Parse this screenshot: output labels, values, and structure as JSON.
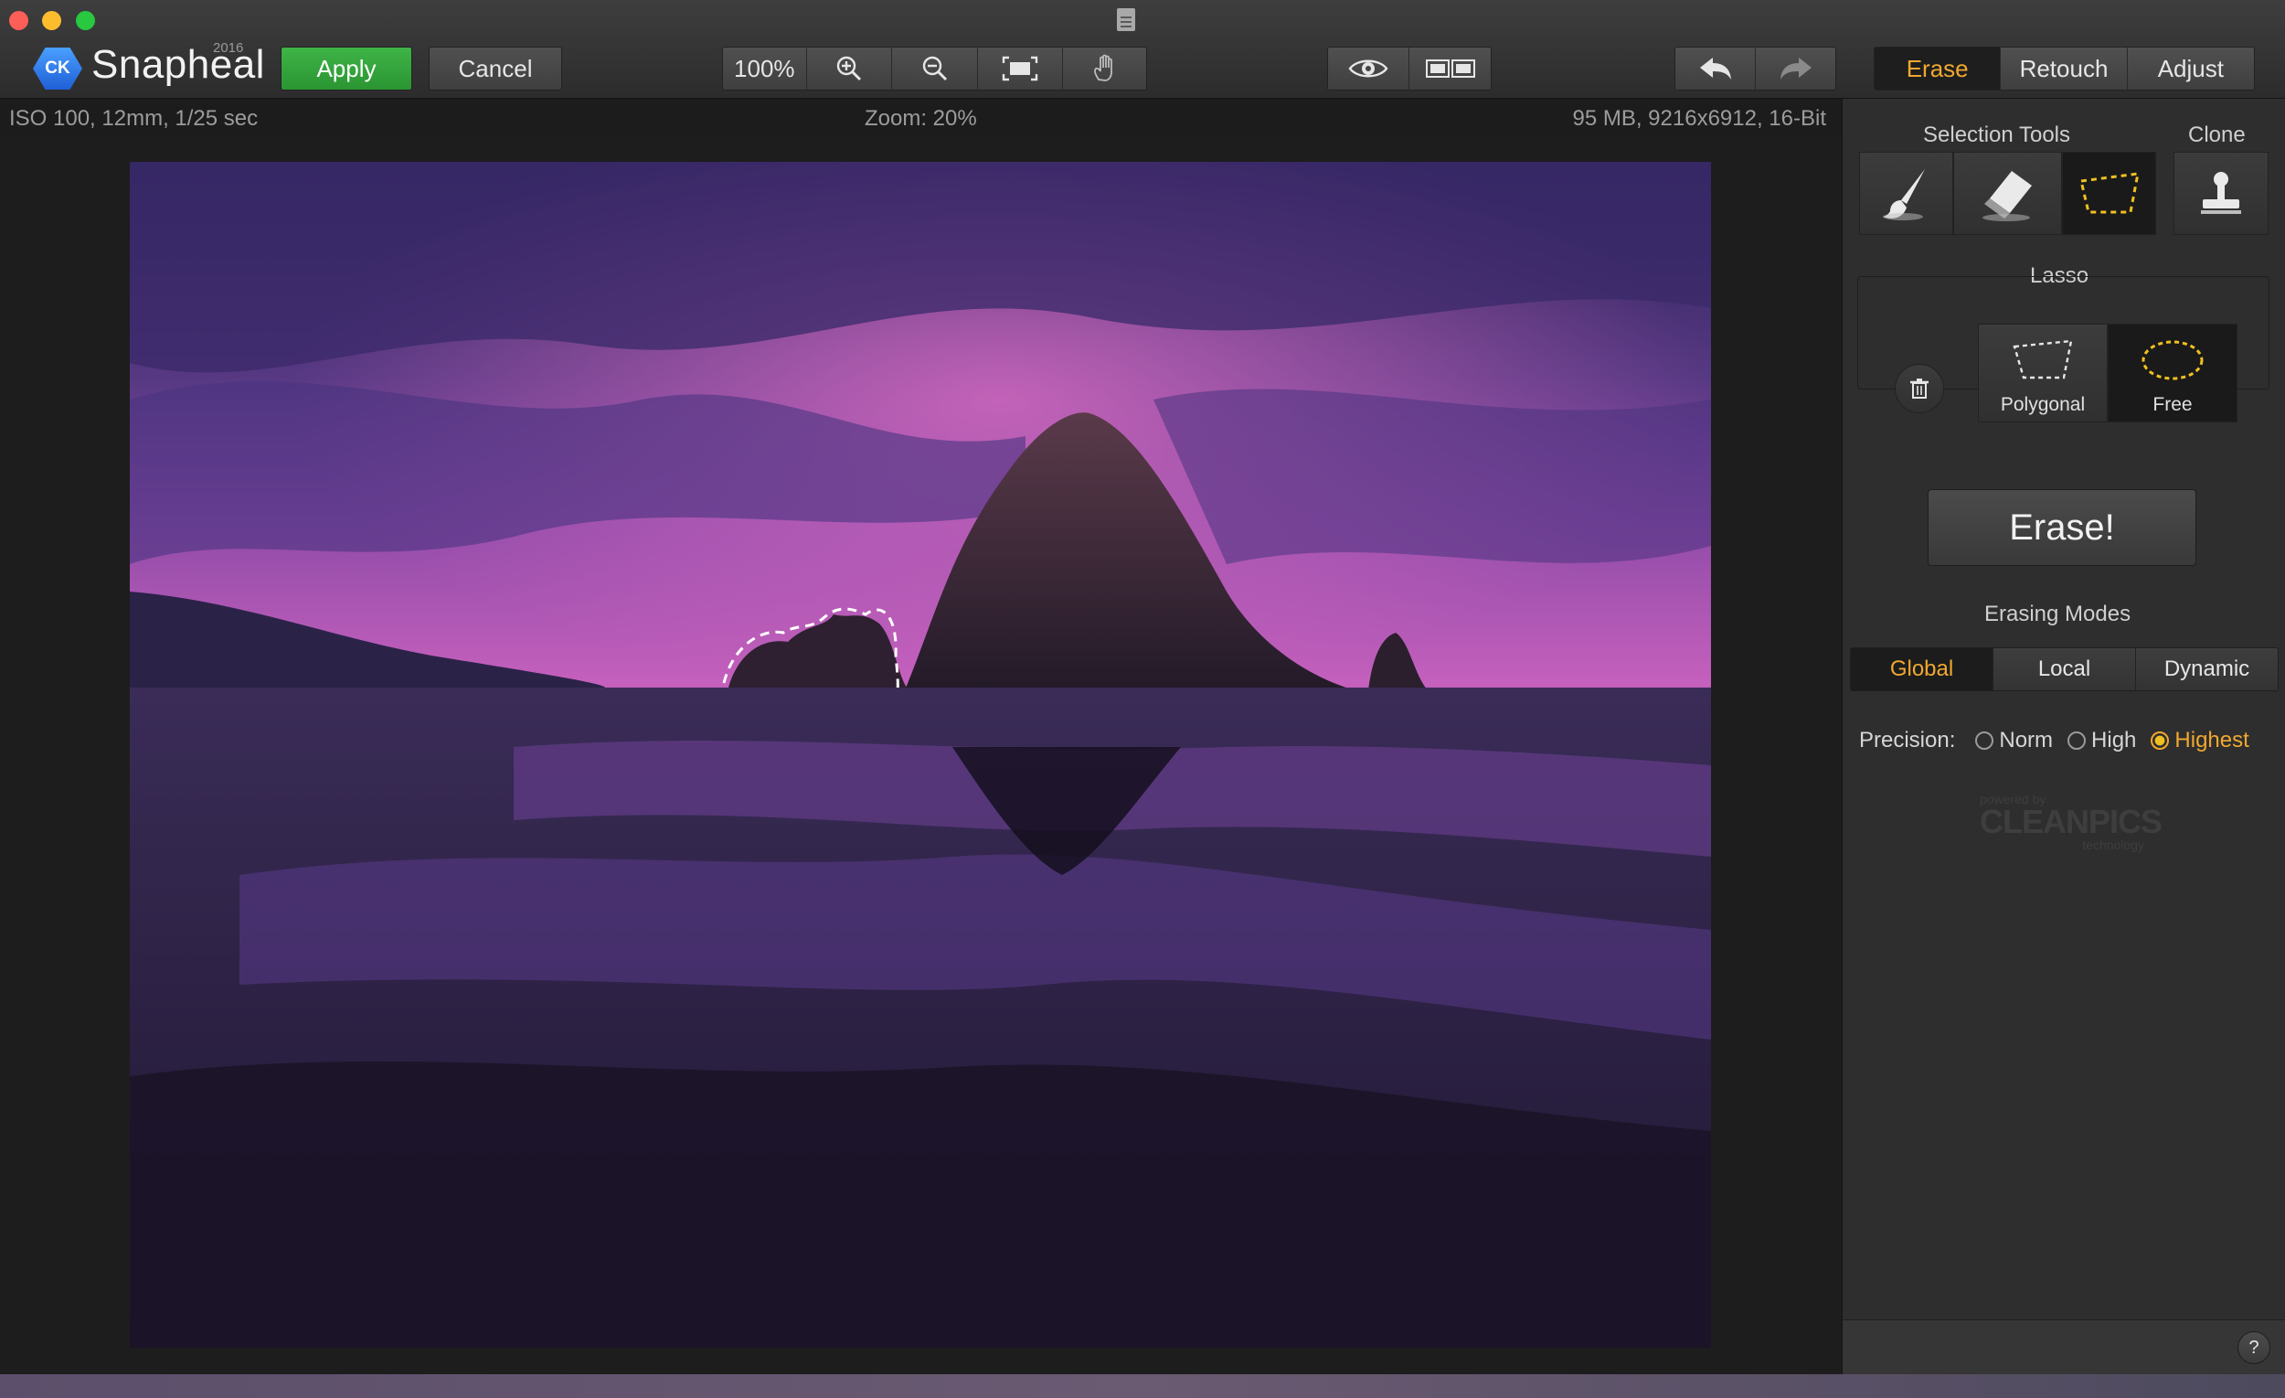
{
  "app": {
    "name": "Snapheal",
    "year": "2016",
    "logo_badge": "CK"
  },
  "toolbar": {
    "apply_label": "Apply",
    "cancel_label": "Cancel",
    "zoom_100_label": "100%",
    "icons": [
      "zoom-in-icon",
      "zoom-out-icon",
      "fit-to-screen-icon",
      "hand-tool-icon",
      "eye-icon",
      "compare-icon",
      "undo-icon",
      "redo-icon"
    ],
    "modes": [
      "Erase",
      "Retouch",
      "Adjust"
    ],
    "active_mode": "Erase"
  },
  "infobar": {
    "exif": "ISO 100, 12mm, 1/25 sec",
    "zoom": "Zoom: 20%",
    "file_info": "95 MB, 9216x6912, 16-Bit"
  },
  "panel": {
    "selection_tools_title": "Selection Tools",
    "clone_title": "Clone",
    "lasso_title": "Lasso",
    "lasso_options": [
      "Polygonal",
      "Free"
    ],
    "erase_button": "Erase!",
    "erasing_modes_title": "Erasing Modes",
    "erasing_modes": [
      "Global",
      "Local",
      "Dynamic"
    ],
    "precision_label": "Precision:",
    "precision_options": [
      "Norm",
      "High",
      "Highest"
    ],
    "precision_selected": "Highest",
    "powered_by": "powered by",
    "cleanpics": "CLEANPICS",
    "technology": "technology",
    "help_label": "?"
  },
  "colors": {
    "accent": "#f0a830",
    "apply_green": "#3fb447",
    "background": "#1c1c1c"
  }
}
